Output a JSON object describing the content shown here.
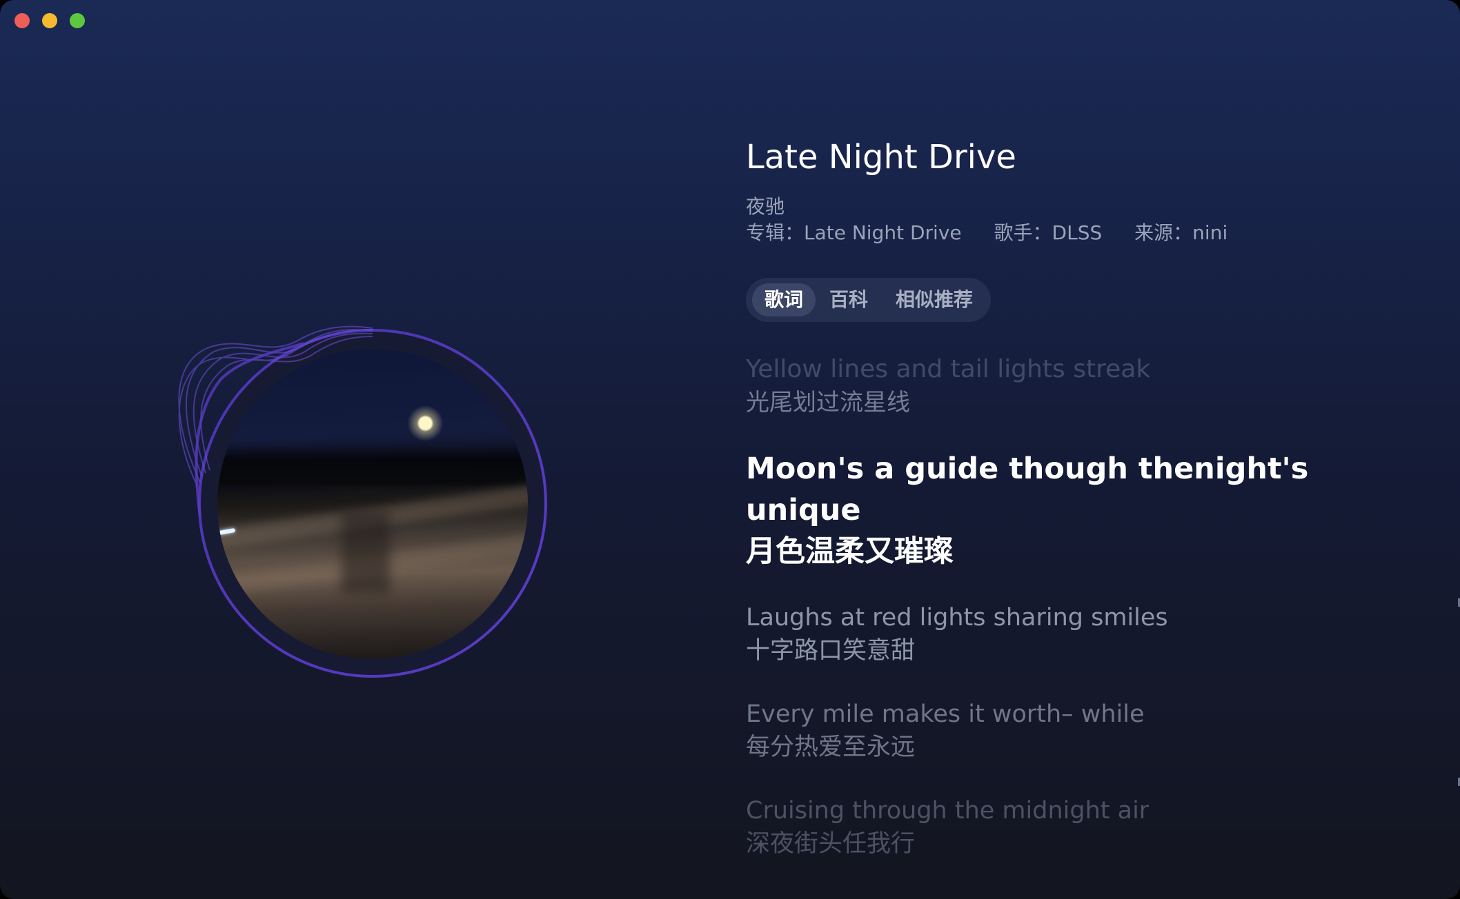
{
  "window": {
    "controls": [
      "close",
      "minimize",
      "zoom"
    ]
  },
  "song": {
    "title": "Late Night Drive",
    "subtitle": "夜驰",
    "album": "专辑：Late Night Drive",
    "artist": "歌手：DLSS",
    "source": "来源：nini"
  },
  "tabs": [
    {
      "label": "歌词",
      "active": true
    },
    {
      "label": "百科",
      "active": false
    },
    {
      "label": "相似推荐",
      "active": false
    }
  ],
  "lyrics": [
    {
      "en": "Yellow lines and tail lights streak",
      "zh": "光尾划过流星线",
      "state": "previous"
    },
    {
      "en_line1": "Moon's a guide though thenight's",
      "en_line2": "unique",
      "zh": "月色温柔又璀璨",
      "state": "current"
    },
    {
      "en": "Laughs at red lights sharing smiles",
      "zh": "十字路口笑意甜",
      "state": "upcoming"
    },
    {
      "en": "Every mile makes it worth– while",
      "zh": "每分热爱至永远",
      "state": "upcoming"
    },
    {
      "en": "Cruising through the midnight air",
      "zh": "深夜街头任我行",
      "state": "upcoming"
    }
  ],
  "colors": {
    "accent_ring": "#5a3bc4",
    "wave": "#7a5ce0",
    "close": "#ee5f57",
    "minimize": "#f4bb2e",
    "zoom": "#5fc73f"
  },
  "icons": {
    "album_art": "night-drive-cover"
  }
}
